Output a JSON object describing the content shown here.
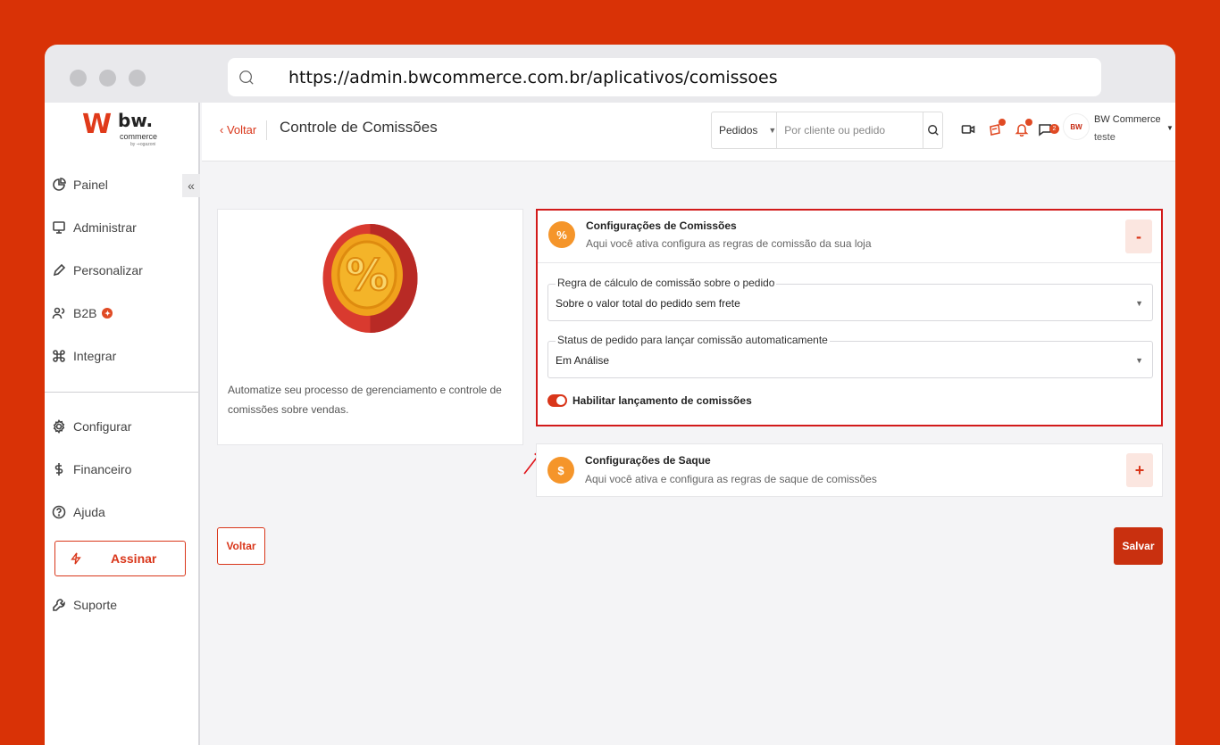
{
  "browser": {
    "url": "https://admin.bwcommerce.com.br/aplicativos/comissoes"
  },
  "logo": {
    "mark": "W",
    "brand": "bw.",
    "sub": "commerce",
    "by": "by ⇝ogazoni"
  },
  "sidebar": {
    "collapse_label": "«",
    "items": [
      {
        "label": "Painel"
      },
      {
        "label": "Administrar"
      },
      {
        "label": "Personalizar"
      },
      {
        "label": "B2B",
        "badge": "✦"
      },
      {
        "label": "Integrar"
      },
      {
        "label": "Configurar"
      },
      {
        "label": "Financeiro"
      },
      {
        "label": "Ajuda"
      },
      {
        "label": "Suporte"
      }
    ],
    "assinar_label": "Assinar"
  },
  "header": {
    "back_label": "‹ Voltar",
    "title": "Controle de Comissões",
    "search_select": "Pedidos",
    "search_placeholder": "Por cliente ou pedido",
    "notification_count": "2",
    "user_name": "BW Commerce",
    "user_sub": "teste",
    "avatar_text": "BW"
  },
  "info_card": {
    "text": "Automatize seu processo de gerenciamento e controle de comissões sobre vendas."
  },
  "comissoes_panel": {
    "icon": "%",
    "title": "Configurações de Comissões",
    "subtitle": "Aqui você ativa configura as regras de comissão da sua loja",
    "toggle": "-",
    "fields": [
      {
        "label": "Regra de cálculo de comissão sobre o pedido",
        "value": "Sobre o valor total do pedido sem frete"
      },
      {
        "label": "Status de pedido para lançar comissão automaticamente",
        "value": "Em Análise"
      }
    ],
    "switch_label": "Habilitar lançamento de comissões",
    "switch_on": true
  },
  "saque_panel": {
    "icon": "$",
    "title": "Configurações de Saque",
    "subtitle": "Aqui você ativa e configura as regras de saque de comissões",
    "toggle": "+"
  },
  "footer": {
    "voltar_label": "Voltar",
    "salvar_label": "Salvar"
  },
  "colors": {
    "brand": "#d93206",
    "accent": "#d9361a",
    "highlight_border": "#d21a1a",
    "panel_icon": "#f5952a"
  }
}
